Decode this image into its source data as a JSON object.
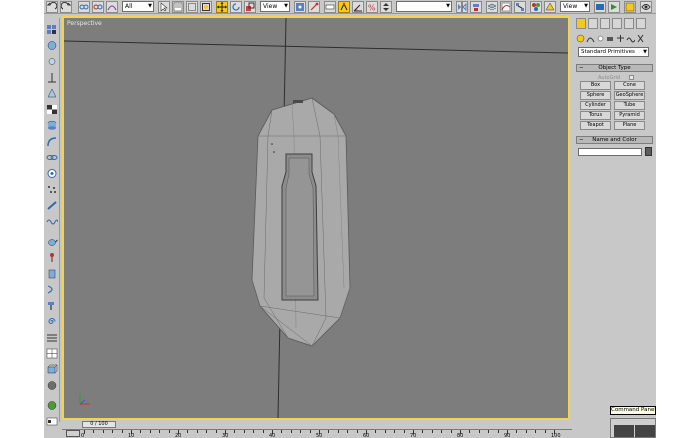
{
  "toolbar": {
    "selection_filter": "All",
    "reference_coord": "View",
    "reference_coord_right": "View",
    "named_selection": ""
  },
  "viewport": {
    "label": "Perspective"
  },
  "command_panel": {
    "category_dropdown": "Standard Primitives",
    "object_type": {
      "title": "Object Type",
      "autogrid": "AutoGrid",
      "buttons": [
        "Box",
        "Cone",
        "Sphere",
        "GeoSphere",
        "Cylinder",
        "Tube",
        "Torus",
        "Pyramid",
        "Teapot",
        "Plane"
      ]
    },
    "name_and_color": {
      "title": "Name and Color",
      "name_value": ""
    },
    "tooltip": "Command Panel",
    "colors": {
      "active": "#f6c81b",
      "viewport_border": "#f1d54c",
      "swatch": "#5c5c5c"
    }
  },
  "timeline": {
    "slider_label": "0 / 100",
    "ticks": [
      "0",
      "10",
      "20",
      "30",
      "40",
      "50",
      "60",
      "70",
      "80",
      "90",
      "100"
    ]
  },
  "icons": {
    "toolbar": [
      "undo-icon",
      "redo-icon",
      "link-icon",
      "unlink-icon",
      "bind-space-warp-icon",
      "select-object-icon",
      "select-by-name-icon",
      "rect-region-icon",
      "window-crossing-icon",
      "move-icon",
      "rotate-icon",
      "scale-icon",
      "pivot-icon",
      "manipulate-icon",
      "keyboard-shortcut-icon",
      "snap-3d-icon",
      "angle-snap-icon",
      "percent-snap-icon",
      "spinner-snap-icon",
      "edit-named-selection-icon",
      "mirror-icon",
      "align-icon",
      "layer-manager-icon",
      "curve-editor-icon",
      "schematic-view-icon",
      "material-editor-icon",
      "render-setup-icon",
      "render-frame-icon",
      "quick-render-icon"
    ]
  }
}
